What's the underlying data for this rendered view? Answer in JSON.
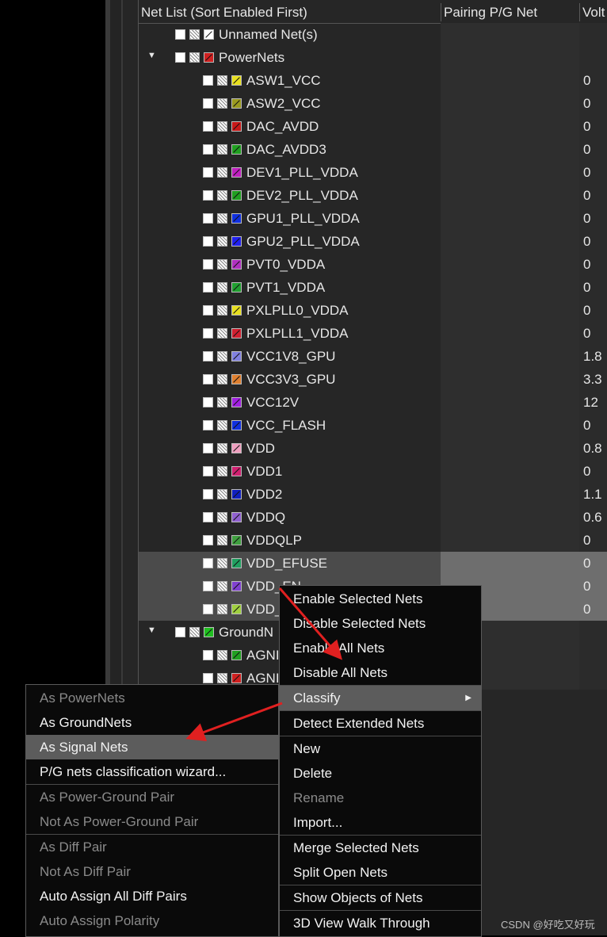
{
  "columns": {
    "net_list": "Net List (Sort Enabled First)",
    "pairing": "Pairing P/G Net",
    "voltage": "Volt"
  },
  "tree": {
    "unnamed": {
      "label": "Unnamed Net(s)"
    },
    "powernets": {
      "label": "PowerNets",
      "color": "#d02020",
      "items": [
        {
          "label": "ASW1_VCC",
          "voltage": "0",
          "color": "#e8e020"
        },
        {
          "label": "ASW2_VCC",
          "voltage": "0",
          "color": "#9a9a20"
        },
        {
          "label": "DAC_AVDD",
          "voltage": "0",
          "color": "#c81818"
        },
        {
          "label": "DAC_AVDD3",
          "voltage": "0",
          "color": "#20a020"
        },
        {
          "label": "DEV1_PLL_VDDA",
          "voltage": "0",
          "color": "#c020c0"
        },
        {
          "label": "DEV2_PLL_VDDA",
          "voltage": "0",
          "color": "#20a020"
        },
        {
          "label": "GPU1_PLL_VDDA",
          "voltage": "0",
          "color": "#1030e0"
        },
        {
          "label": "GPU2_PLL_VDDA",
          "voltage": "0",
          "color": "#2020f0"
        },
        {
          "label": "PVT0_VDDA",
          "voltage": "0",
          "color": "#b030c0"
        },
        {
          "label": "PVT1_VDDA",
          "voltage": "0",
          "color": "#20a030"
        },
        {
          "label": "PXLPLL0_VDDA",
          "voltage": "0",
          "color": "#e8e020"
        },
        {
          "label": "PXLPLL1_VDDA",
          "voltage": "0",
          "color": "#d02030"
        },
        {
          "label": "VCC1V8_GPU",
          "voltage": "1.8",
          "color": "#8080e0"
        },
        {
          "label": "VCC3V3_GPU",
          "voltage": "3.3",
          "color": "#e08030"
        },
        {
          "label": "VCC12V",
          "voltage": "12",
          "color": "#a020e0"
        },
        {
          "label": "VCC_FLASH",
          "voltage": "0",
          "color": "#1030e0"
        },
        {
          "label": "VDD",
          "voltage": "0.8",
          "color": "#f0a0c0"
        },
        {
          "label": "VDD1",
          "voltage": "0",
          "color": "#d02070"
        },
        {
          "label": "VDD2",
          "voltage": "1.1",
          "color": "#1020c0"
        },
        {
          "label": "VDDQ",
          "voltage": "0.6",
          "color": "#9060d0"
        },
        {
          "label": "VDDQLP",
          "voltage": "0",
          "color": "#40a040"
        },
        {
          "label": "VDD_EFUSE",
          "voltage": "0",
          "color": "#20a060",
          "selected": true
        },
        {
          "label": "VDD_EN",
          "voltage": "0",
          "color": "#8040d0",
          "selected": true
        },
        {
          "label": "VDD_",
          "voltage": "0",
          "color": "#a0d040",
          "selected": true
        }
      ]
    },
    "groundnets": {
      "label": "GroundN",
      "color": "#20c020",
      "items": [
        {
          "label": "AGNI",
          "color": "#20a020"
        },
        {
          "label": "AGNI",
          "color": "#d02020"
        }
      ]
    }
  },
  "context_menu": {
    "items": [
      {
        "label": "Enable Selected Nets",
        "disabled": false
      },
      {
        "label": "Disable Selected Nets",
        "disabled": false
      },
      {
        "label": "Enable All Nets",
        "disabled": false
      },
      {
        "label": "Disable All Nets",
        "disabled": false
      },
      {
        "label": "Classify",
        "disabled": false,
        "highlighted": true,
        "submenu": true
      },
      {
        "label": "Detect Extended Nets",
        "disabled": false
      },
      {
        "label": "New",
        "disabled": false
      },
      {
        "label": "Delete",
        "disabled": false
      },
      {
        "label": "Rename",
        "disabled": true
      },
      {
        "label": "Import...",
        "disabled": false
      },
      {
        "label": "Merge Selected Nets",
        "disabled": false
      },
      {
        "label": "Split Open Nets",
        "disabled": false
      },
      {
        "label": "Show Objects of Nets",
        "disabled": false
      },
      {
        "label": "3D View Walk Through",
        "disabled": false
      }
    ]
  },
  "classify_submenu": {
    "items": [
      {
        "label": "As PowerNets",
        "disabled": true
      },
      {
        "label": "As GroundNets",
        "disabled": false
      },
      {
        "label": "As Signal Nets",
        "disabled": false,
        "highlighted": true
      },
      {
        "label": "P/G nets classification wizard...",
        "disabled": false
      },
      {
        "label": "As Power-Ground Pair",
        "disabled": true
      },
      {
        "label": "Not As Power-Ground Pair",
        "disabled": true
      },
      {
        "label": "As Diff Pair",
        "disabled": true
      },
      {
        "label": "Not As Diff Pair",
        "disabled": true
      },
      {
        "label": "Auto Assign All Diff Pairs",
        "disabled": false
      },
      {
        "label": "Auto Assign Polarity",
        "disabled": true
      }
    ]
  },
  "annotation_color": "#e02020",
  "watermark": "CSDN @好吃又好玩"
}
